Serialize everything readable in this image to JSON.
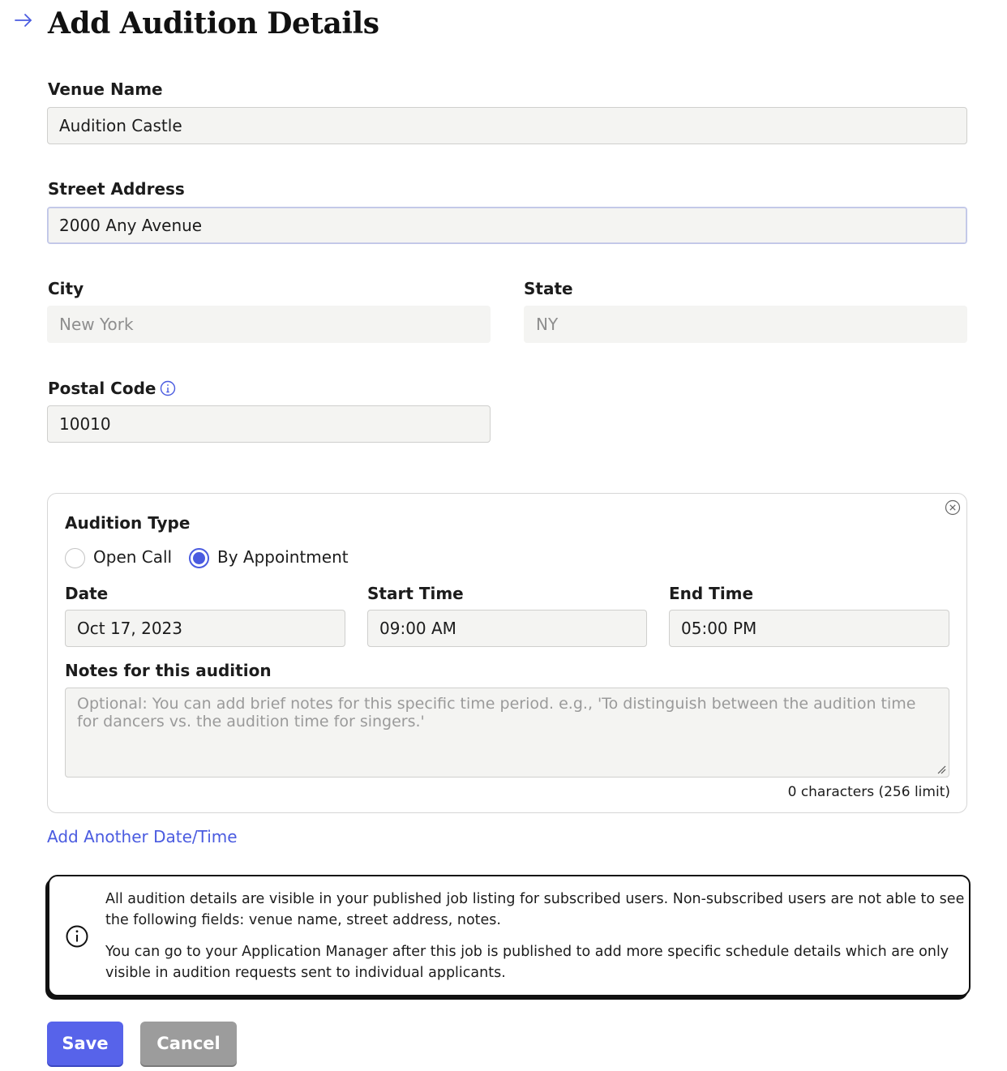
{
  "header": {
    "title": "Add Audition Details",
    "back_icon": "arrow-right-icon"
  },
  "venue": {
    "label": "Venue Name",
    "value": "Audition Castle"
  },
  "street": {
    "label": "Street Address",
    "value": "2000 Any Avenue"
  },
  "city": {
    "label": "City",
    "value": "New York"
  },
  "state": {
    "label": "State",
    "value": "NY"
  },
  "postal": {
    "label": "Postal Code",
    "value": "10010",
    "info_icon": "info-icon"
  },
  "audition": {
    "type_label": "Audition Type",
    "options": [
      {
        "label": "Open Call",
        "checked": false
      },
      {
        "label": "By Appointment",
        "checked": true
      }
    ],
    "date": {
      "label": "Date",
      "value": "Oct 17, 2023"
    },
    "start": {
      "label": "Start Time",
      "value": "09:00 AM"
    },
    "end": {
      "label": "End Time",
      "value": "05:00 PM"
    },
    "notes": {
      "label": "Notes for this audition",
      "placeholder": "Optional: You can add brief notes for this specific time period. e.g., 'To distinguish between the audition time for dancers vs. the audition time for singers.'",
      "count": "0 characters (256 limit)"
    },
    "remove_icon": "close-circle-icon"
  },
  "add_link": "Add Another Date/Time",
  "notice": {
    "p1": "All audition details are visible in your published job listing for subscribed users. Non-subscribed users are not able to see the following fields: venue name, street address, notes.",
    "p2": "You can go to your Application Manager after this job is published to add more specific schedule details which are only visible in audition requests sent to individual applicants."
  },
  "buttons": {
    "save": "Save",
    "cancel": "Cancel"
  },
  "colors": {
    "accent": "#4a5be0",
    "save_bg": "#5763ea",
    "cancel_bg": "#9c9c9c"
  }
}
